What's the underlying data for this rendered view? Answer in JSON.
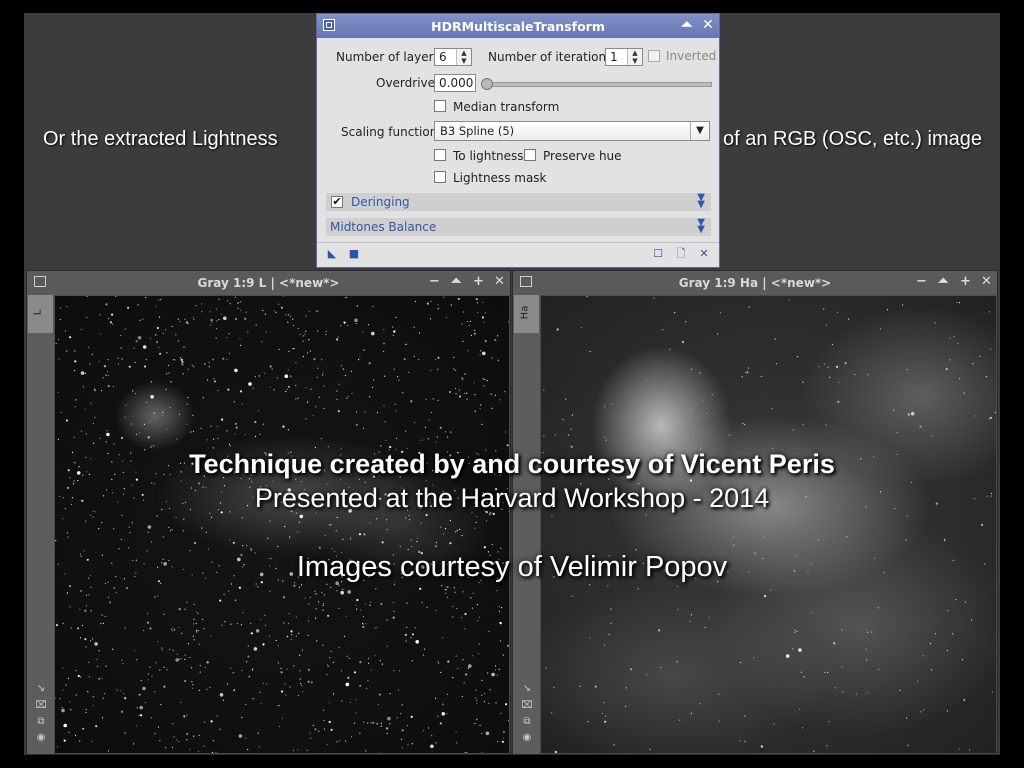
{
  "captions": {
    "left": "Or the extracted Lightness",
    "right": "of an RGB (OSC, etc.) image"
  },
  "dialog": {
    "title": "HDRMultiscaleTransform",
    "shade_icon": "⏶",
    "close_icon": "✕",
    "layers_label": "Number of layers:",
    "layers_value": "6",
    "iterations_label": "Number of iterations:",
    "iterations_value": "1",
    "inverted_label": "Inverted",
    "overdrive_label": "Overdrive:",
    "overdrive_value": "0.000",
    "median_label": "Median transform",
    "scaling_label": "Scaling function:",
    "scaling_value": "B3 Spline (5)",
    "to_lightness_label": "To lightness",
    "preserve_hue_label": "Preserve hue",
    "lightness_mask_label": "Lightness mask",
    "deringing_label": "Deringing",
    "deringing_checked": true,
    "midtones_label": "Midtones Balance",
    "inverted_checked": false,
    "median_checked": false,
    "to_lightness_checked": false,
    "preserve_hue_checked": false,
    "lightness_mask_checked": false
  },
  "windows": [
    {
      "title": "Gray 1:9 L | <*new*>",
      "tab": "L"
    },
    {
      "title": "Gray 1:9 Ha | <*new*>",
      "tab": "Ha"
    }
  ],
  "window_buttons": {
    "minimize": "−",
    "shade": "⏶",
    "maximize": "+",
    "close": "✕"
  },
  "overlay": {
    "line1": "Technique created by and courtesy of Vicent Peris",
    "line2": "Presented at the Harvard Workshop - 2014",
    "line3": "Images courtesy of Velimir Popov"
  },
  "colors": {
    "dialog_title": "#6f80bd",
    "section_text": "#2f58a8",
    "background": "#3c3c3c"
  }
}
